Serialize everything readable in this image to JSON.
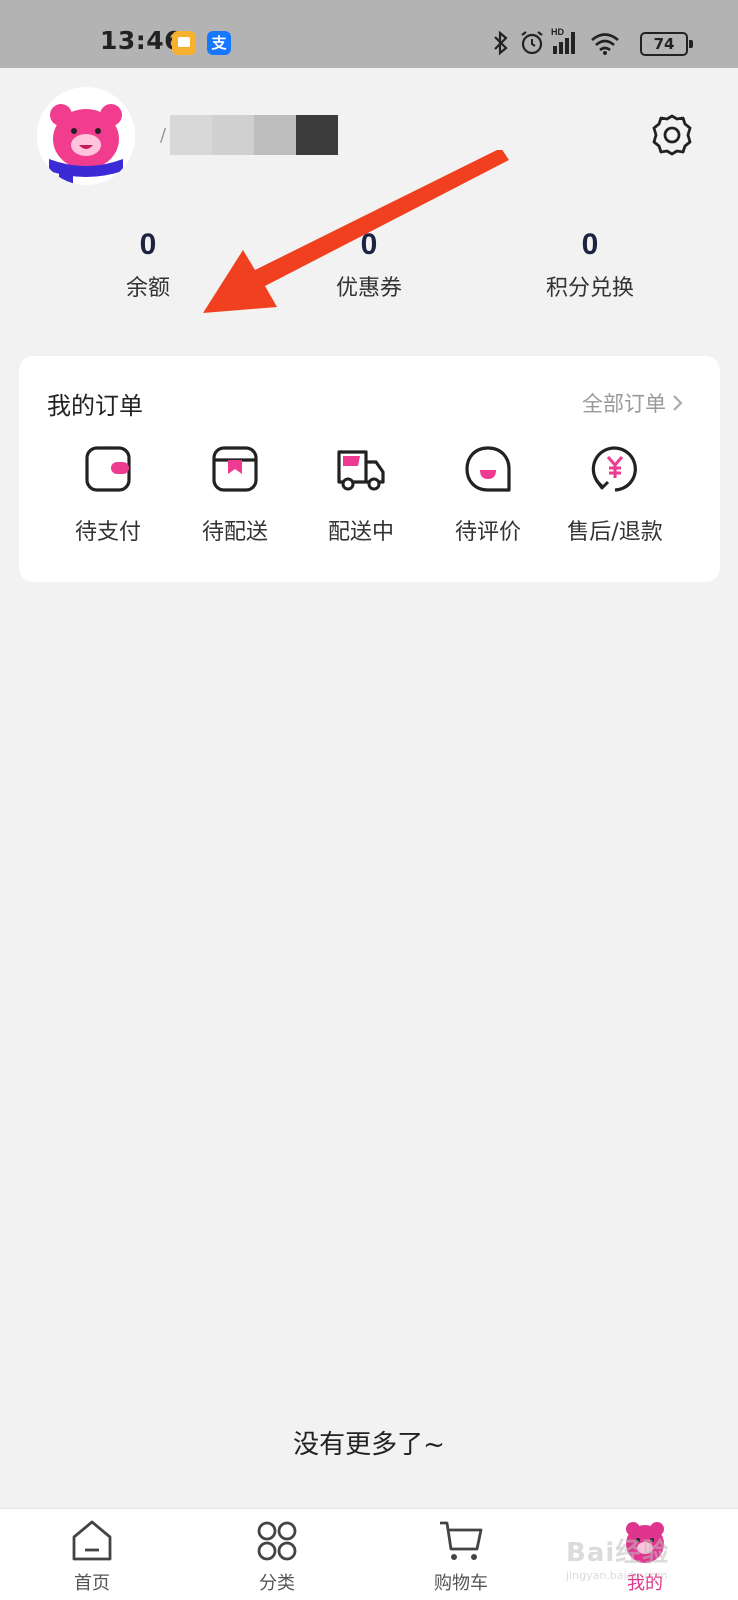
{
  "status_bar": {
    "time": "13:46",
    "icons": [
      "notes-app-icon",
      "alipay-icon",
      "bluetooth-icon",
      "alarm-icon",
      "hd-signal-icon",
      "wifi-icon"
    ],
    "alipay_glyph": "支",
    "battery": "74"
  },
  "profile": {
    "username_prefix": "/"
  },
  "stats": [
    {
      "value": "0",
      "label": "余额"
    },
    {
      "value": "0",
      "label": "优惠券"
    },
    {
      "value": "0",
      "label": "积分兑换"
    }
  ],
  "orders": {
    "title": "我的订单",
    "all_label": "全部订单",
    "items": [
      {
        "label": "待支付",
        "icon": "wallet-icon"
      },
      {
        "label": "待配送",
        "icon": "package-icon"
      },
      {
        "label": "配送中",
        "icon": "truck-icon"
      },
      {
        "label": "待评价",
        "icon": "smile-bubble-icon"
      },
      {
        "label": "售后/退款",
        "icon": "refund-icon"
      }
    ]
  },
  "footer_text": "没有更多了~",
  "bottom_nav": [
    {
      "label": "首页",
      "icon": "home-icon"
    },
    {
      "label": "分类",
      "icon": "grid-icon"
    },
    {
      "label": "购物车",
      "icon": "cart-icon"
    },
    {
      "label": "我的",
      "icon": "profile-bear-icon",
      "active": true
    }
  ],
  "watermark": {
    "text": "Bai",
    "text2": "经验",
    "sub": "jingyan.baidu.com"
  },
  "colors": {
    "accent": "#e0358f",
    "stat_number": "#1c2340",
    "arrow": "#f0401f",
    "page_bg": "#f2f2f2"
  }
}
